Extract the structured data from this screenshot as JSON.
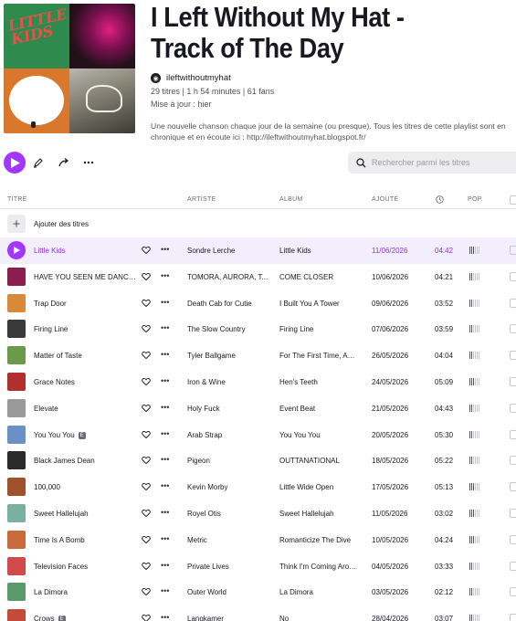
{
  "playlist": {
    "title": "I Left Without My Hat - Track of The Day",
    "owner": "ileftwithoutmyhat",
    "stats": "29 titres | 1 h 54 minutes | 61 fans",
    "updated": "Mise à jour : hier",
    "description": "Une nouvelle chanson chaque jour de la semaine (ou presque). Tous les titres de cette playlist sont en chronique et en écoute ici : http://ileftwithoutmyhat.blogspot.fr/",
    "cover_text": "LITTLE KIDS"
  },
  "toolbar": {
    "search_placeholder": "Rechercher parmi les titres"
  },
  "columns": {
    "title": "TITRE",
    "artist": "ARTISTE",
    "album": "ALBUM",
    "added": "AJOUTÉ",
    "popularity": "POP."
  },
  "add_tracks_label": "Ajouter des titres",
  "accent_color": "#a238ff",
  "tracks": [
    {
      "title": "Little Kids",
      "artist": "Sondre Lerche",
      "album": "Little Kids",
      "added": "11/06/2026",
      "duration": "04:42",
      "explicit": false,
      "active": true,
      "thumb": "#c54a6a",
      "pop": 3
    },
    {
      "title": "HAVE YOU SEEN ME DANCE A...",
      "artist": "TOMORA, AURORA, T...",
      "album": "COME CLOSER",
      "added": "10/06/2026",
      "duration": "04:21",
      "explicit": false,
      "thumb": "#8a1f4f",
      "pop": 2
    },
    {
      "title": "Trap Door",
      "artist": "Death Cab for Cutie",
      "album": "I Built You A Tower",
      "added": "09/06/2026",
      "duration": "03:52",
      "explicit": false,
      "thumb": "#d88a3a",
      "pop": 2
    },
    {
      "title": "Firing Line",
      "artist": "The Slow Country",
      "album": "Firing Line",
      "added": "07/06/2026",
      "duration": "03:59",
      "explicit": false,
      "thumb": "#3a3a3a",
      "pop": 2
    },
    {
      "title": "Matter of Taste",
      "artist": "Tyler Ballgame",
      "album": "For The First Time, Ag...",
      "added": "26/05/2026",
      "duration": "04:04",
      "explicit": false,
      "thumb": "#6a9a4a",
      "pop": 2
    },
    {
      "title": "Grace Notes",
      "artist": "Iron & Wine",
      "album": "Hen's Teeth",
      "added": "24/05/2026",
      "duration": "05:09",
      "explicit": false,
      "thumb": "#b03030",
      "pop": 3
    },
    {
      "title": "Elevate",
      "artist": "Holy Fuck",
      "album": "Event Beat",
      "added": "21/05/2026",
      "duration": "04:43",
      "explicit": false,
      "thumb": "#9a9a9a",
      "pop": 2
    },
    {
      "title": "You You You",
      "artist": "Arab Strap",
      "album": "You You You",
      "added": "20/05/2026",
      "duration": "05:30",
      "explicit": true,
      "thumb": "#6b8fc7",
      "pop": 2
    },
    {
      "title": "Black James Dean",
      "artist": "Pigeon",
      "album": "OUTTANATIONAL",
      "added": "18/05/2026",
      "duration": "05:22",
      "explicit": false,
      "thumb": "#2a2a2a",
      "pop": 2
    },
    {
      "title": "100,000",
      "artist": "Kevin Morby",
      "album": "Little Wide Open",
      "added": "17/05/2026",
      "duration": "05:13",
      "explicit": false,
      "thumb": "#a0522d",
      "pop": 3
    },
    {
      "title": "Sweet Hallelujah",
      "artist": "Royel Otis",
      "album": "Sweet Hallelujah",
      "added": "11/05/2026",
      "duration": "03:02",
      "explicit": false,
      "thumb": "#7ab0a0",
      "pop": 3
    },
    {
      "title": "Time Is A Bomb",
      "artist": "Metric",
      "album": "Romanticize The Dive",
      "added": "10/05/2026",
      "duration": "04:24",
      "explicit": false,
      "thumb": "#c86a3a",
      "pop": 3
    },
    {
      "title": "Television Faces",
      "artist": "Private Lives",
      "album": "Think I'm Coming Arou...",
      "added": "04/05/2026",
      "duration": "03:33",
      "explicit": false,
      "thumb": "#d04a4a",
      "pop": 2
    },
    {
      "title": "La Dimora",
      "artist": "Outer World",
      "album": "La Dimora",
      "added": "03/05/2026",
      "duration": "02:12",
      "explicit": false,
      "thumb": "#5a9a6a",
      "pop": 2
    },
    {
      "title": "Crows",
      "artist": "Langkamer",
      "album": "No",
      "added": "28/04/2026",
      "duration": "03:07",
      "explicit": true,
      "thumb": "#c44a3a",
      "pop": 2
    }
  ]
}
